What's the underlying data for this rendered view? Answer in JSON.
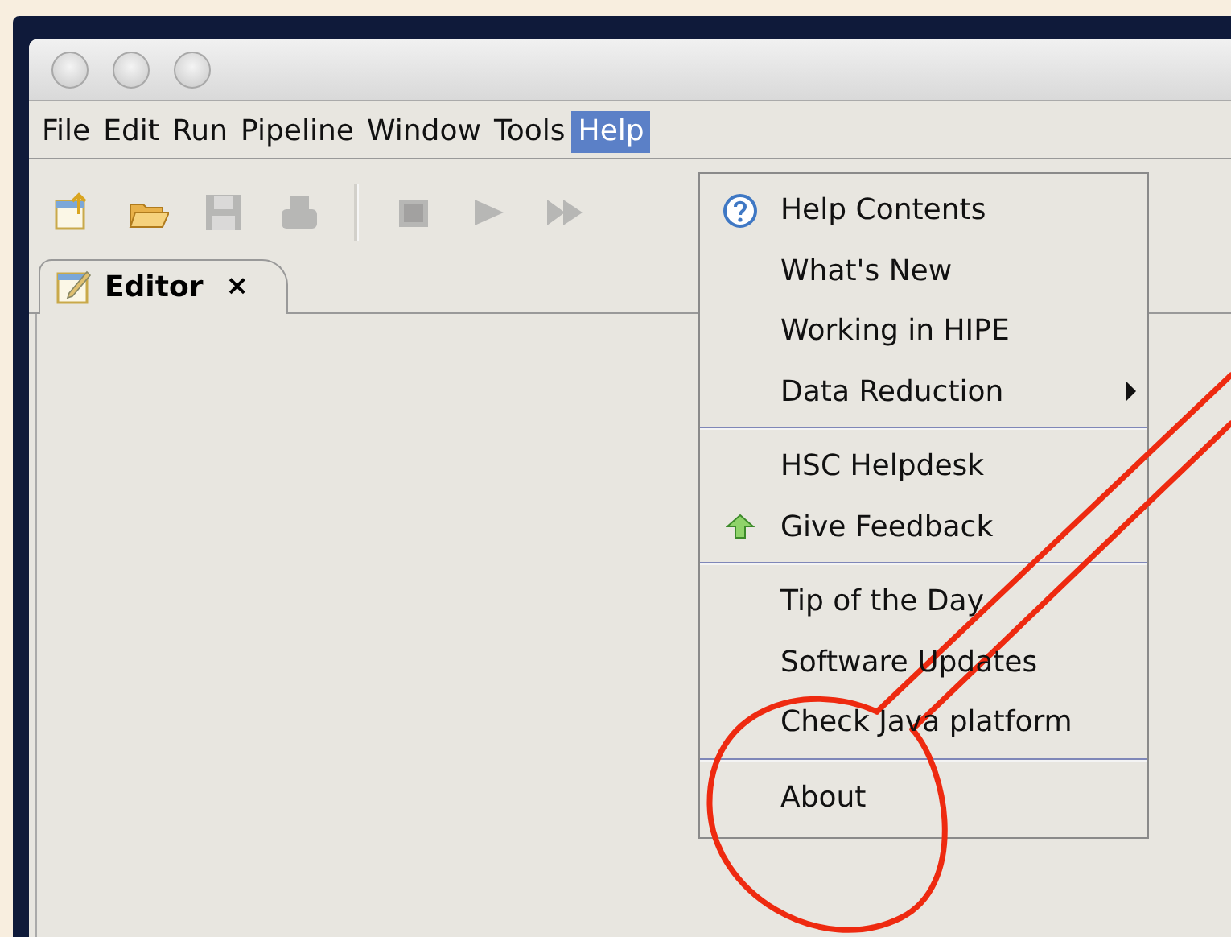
{
  "menu_bar": [
    {
      "label": "File",
      "selected": false
    },
    {
      "label": "Edit",
      "selected": false
    },
    {
      "label": "Run",
      "selected": false
    },
    {
      "label": "Pipeline",
      "selected": false
    },
    {
      "label": "Window",
      "selected": false
    },
    {
      "label": "Tools",
      "selected": false
    },
    {
      "label": "Help",
      "selected": true
    }
  ],
  "toolbar": [
    {
      "kind": "new",
      "disabled": false
    },
    {
      "kind": "open",
      "disabled": false
    },
    {
      "kind": "save",
      "disabled": true
    },
    {
      "kind": "print",
      "disabled": true
    },
    {
      "kind": "separator"
    },
    {
      "kind": "stop",
      "disabled": true
    },
    {
      "kind": "run",
      "disabled": true
    },
    {
      "kind": "run-all",
      "disabled": true
    }
  ],
  "tabs": [
    {
      "label": "Editor",
      "selected": true,
      "close": "×"
    }
  ],
  "help_menu": [
    [
      {
        "label": "Help Contents",
        "kind": "help"
      },
      {
        "label": "What's New",
        "kind": "plain"
      },
      {
        "label": "Working in HIPE",
        "kind": "plain"
      },
      {
        "label": "Data Reduction",
        "kind": "submenu"
      }
    ],
    [
      {
        "label": "HSC Helpdesk",
        "kind": "plain"
      },
      {
        "label": "Give Feedback",
        "kind": "feedback"
      }
    ],
    [
      {
        "label": "Tip of the Day",
        "kind": "plain"
      },
      {
        "label": "Software Updates",
        "kind": "plain"
      },
      {
        "label": "Check Java platform",
        "kind": "plain"
      }
    ],
    [
      {
        "label": "About",
        "kind": "plain"
      }
    ]
  ]
}
